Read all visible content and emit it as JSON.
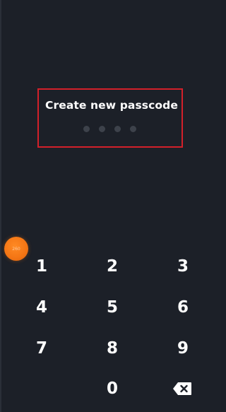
{
  "app": {
    "accent_color": "#f47514",
    "highlight_color": "#d3202a",
    "background_color": "#1c2028"
  },
  "passcode": {
    "title": "Create new passcode",
    "entered_digits": 0,
    "total_digits": 4
  },
  "floating_button": {
    "label": "260"
  },
  "keypad": {
    "keys": [
      "1",
      "2",
      "3",
      "4",
      "5",
      "6",
      "7",
      "8",
      "9",
      "0"
    ],
    "backspace_icon": "backspace-icon"
  }
}
